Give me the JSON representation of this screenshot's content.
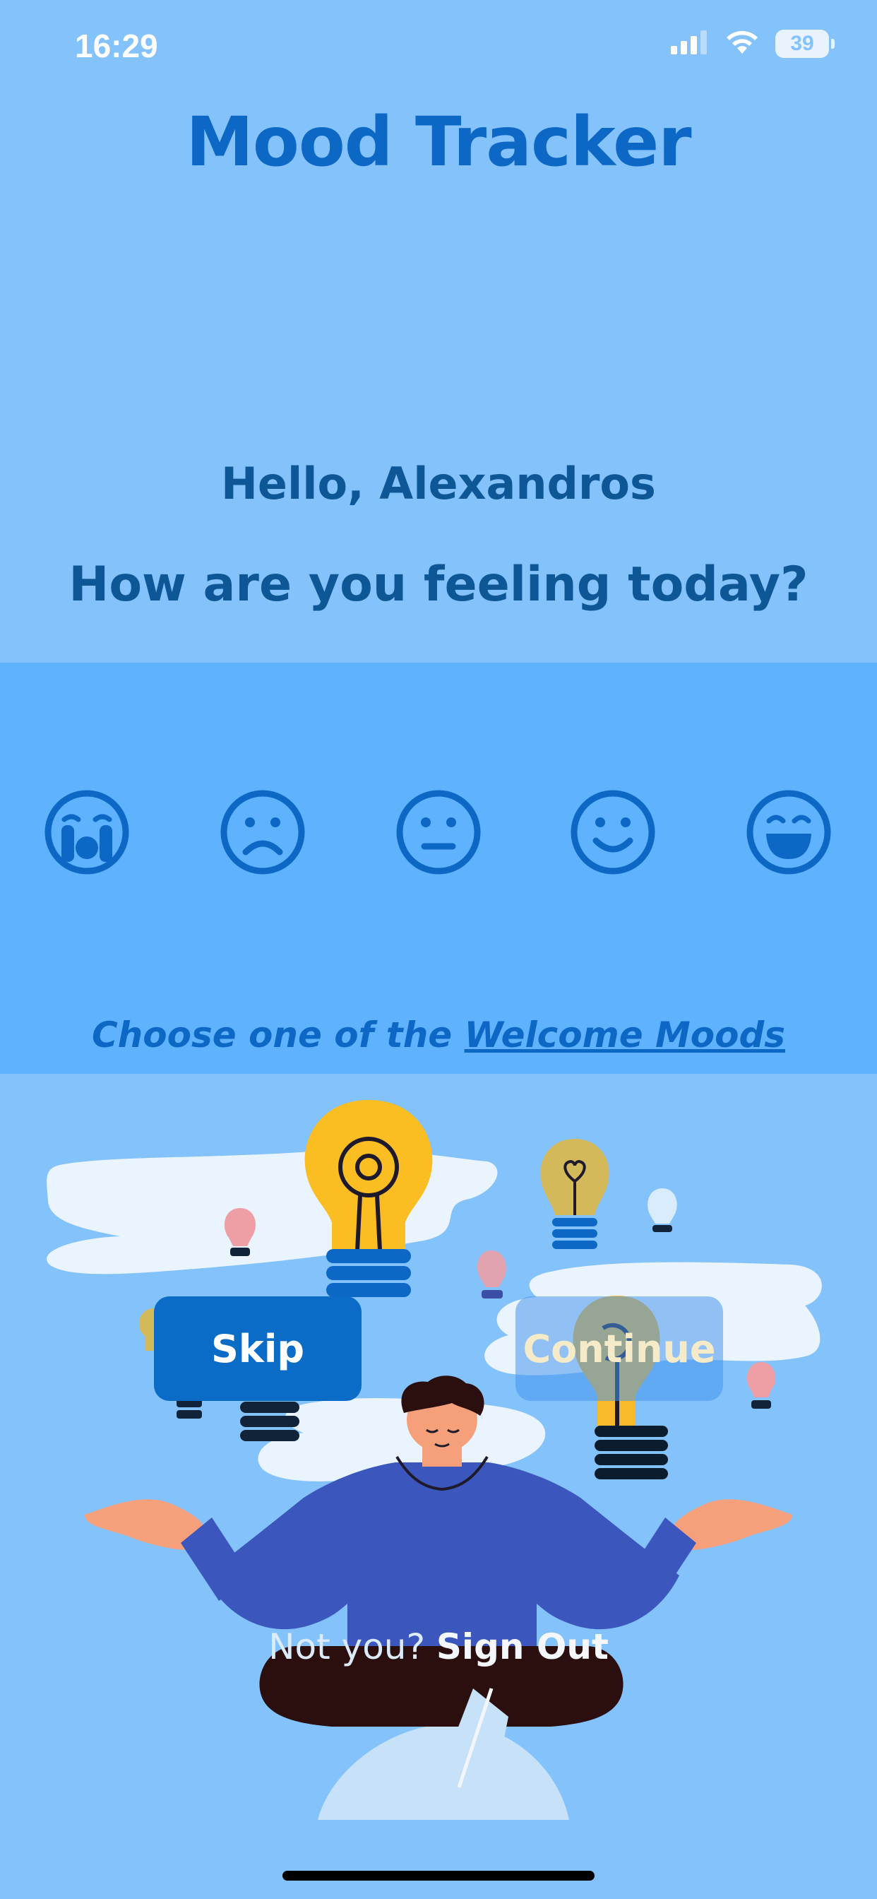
{
  "status": {
    "time": "16:29",
    "battery": "39",
    "icons": [
      "cellular-signal-icon",
      "wifi-icon",
      "battery-icon"
    ]
  },
  "app": {
    "title": "Mood Tracker"
  },
  "greeting": "Hello, Alexandros",
  "question": "How are you feeling today?",
  "moods": [
    {
      "icon": "crying-face-icon"
    },
    {
      "icon": "frowning-face-icon"
    },
    {
      "icon": "neutral-face-icon"
    },
    {
      "icon": "smiling-face-icon"
    },
    {
      "icon": "grinning-face-icon"
    }
  ],
  "choose": {
    "prefix": "Choose one of the ",
    "link": "Welcome Moods"
  },
  "buttons": {
    "skip": "Skip",
    "continue": "Continue"
  },
  "signout": {
    "prompt": "Not you? ",
    "action": "Sign Out"
  },
  "colors": {
    "background": "#84C2FC",
    "mood_band": "#5EB2FE",
    "primary": "#0D68C5",
    "heading": "#0E5796"
  }
}
